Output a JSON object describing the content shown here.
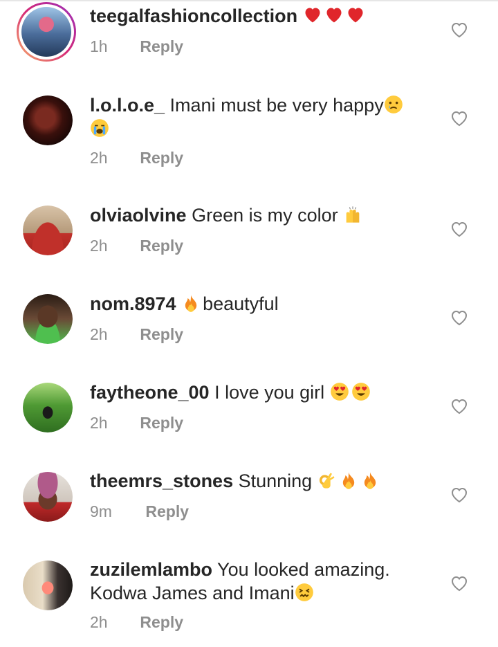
{
  "comments": [
    {
      "user": "teegalfashioncollection",
      "text": "",
      "emojis": [
        "heart",
        "heart",
        "heart"
      ],
      "time": "1h",
      "reply": "Reply",
      "story": true
    },
    {
      "user": "l.o.l.o.e_",
      "text": "Imani must be very happy",
      "emojis": [
        "crying",
        "sobbing"
      ],
      "time": "2h",
      "reply": "Reply"
    },
    {
      "user": "olviaolvine",
      "text": "Green is my color",
      "emojis": [
        "raised-hands"
      ],
      "time": "2h",
      "reply": "Reply"
    },
    {
      "user": "nom.8974",
      "text": "beautyful",
      "emojis": [
        "fire"
      ],
      "time": "2h",
      "reply": "Reply"
    },
    {
      "user": "faytheone_00",
      "text": "I love you girl",
      "emojis": [
        "heart-eyes",
        "heart-eyes"
      ],
      "time": "2h",
      "reply": "Reply"
    },
    {
      "user": "theemrs_stones",
      "text": "Stunning",
      "emojis": [
        "ok-hand",
        "fire",
        "fire"
      ],
      "time": "9m",
      "reply": "Reply"
    },
    {
      "user": "zuzilemlambo",
      "text": "You looked amazing.",
      "text2": "Kodwa James and Imani",
      "emojis": [
        "confounded"
      ],
      "time": "2h",
      "reply": "Reply"
    }
  ],
  "colors": {
    "text": "#262626",
    "muted": "#8e8e8e",
    "heart": "#e0262b",
    "emoji": "#ffcb3d"
  },
  "icons": {
    "like": "heart-outline-icon"
  }
}
